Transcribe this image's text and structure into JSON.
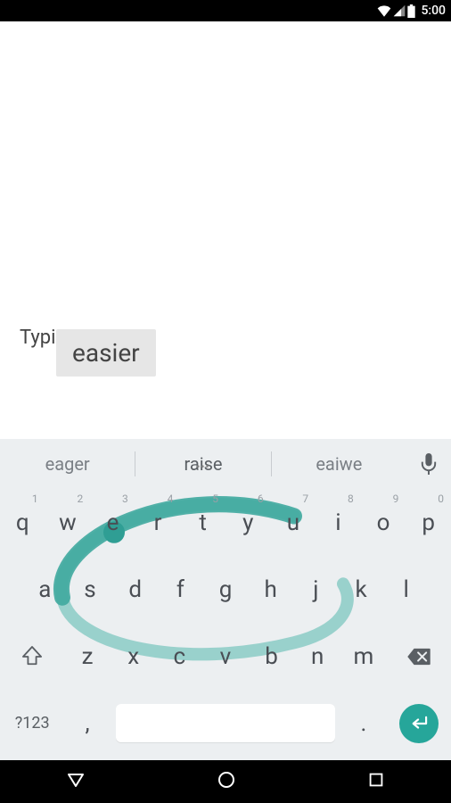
{
  "statusbar": {
    "time": "5:00"
  },
  "content": {
    "typed_text": "Typing is",
    "current_word_popup": "easier"
  },
  "keyboard": {
    "suggestions": {
      "left": "eager",
      "center": "raise",
      "right": "eaiwe"
    },
    "row1": {
      "keys": [
        "q",
        "w",
        "e",
        "r",
        "t",
        "y",
        "u",
        "i",
        "o",
        "p"
      ],
      "nums": [
        "1",
        "2",
        "3",
        "4",
        "5",
        "6",
        "7",
        "8",
        "9",
        "0"
      ]
    },
    "row2": {
      "keys": [
        "a",
        "s",
        "d",
        "f",
        "g",
        "h",
        "j",
        "k",
        "l"
      ]
    },
    "row3": {
      "keys": [
        "z",
        "x",
        "c",
        "v",
        "b",
        "n",
        "m"
      ]
    },
    "row4": {
      "symbols_label": "?123",
      "comma": ",",
      "period": "."
    }
  }
}
